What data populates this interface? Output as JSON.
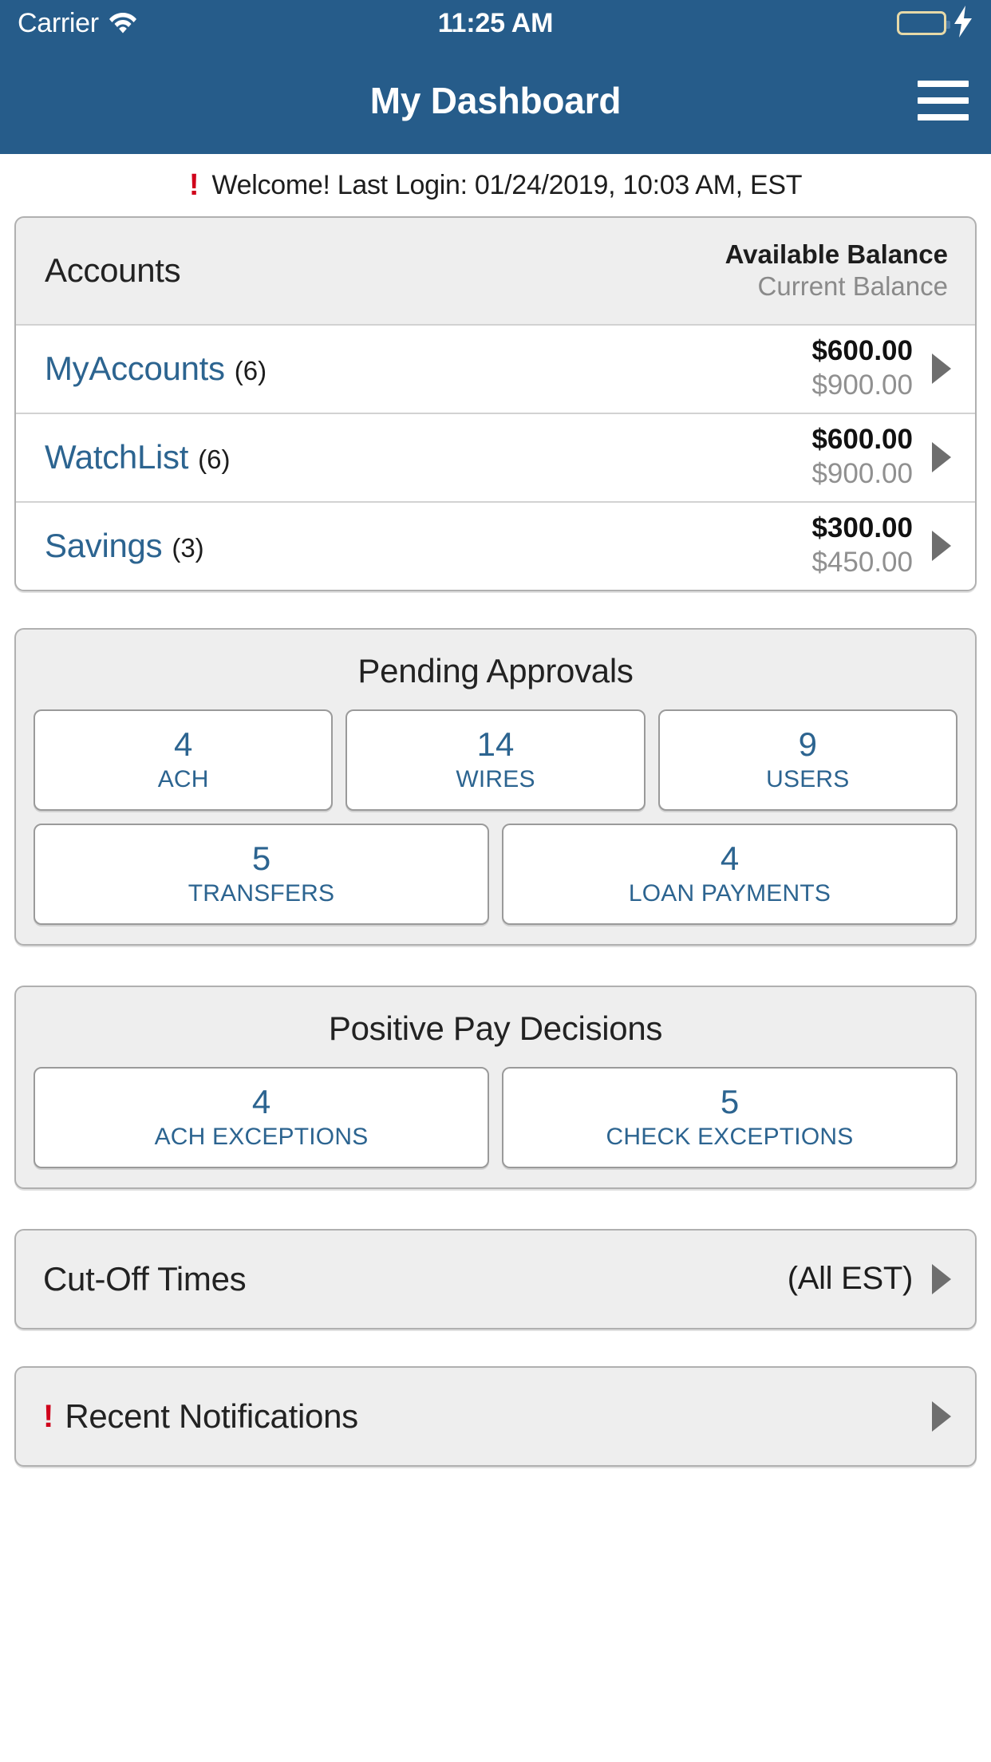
{
  "status_bar": {
    "carrier": "Carrier",
    "time": "11:25 AM",
    "wifi_icon": "wifi-icon",
    "battery_icon": "battery-icon",
    "charging_icon": "lightning-bolt-icon"
  },
  "nav": {
    "title": "My Dashboard",
    "menu_icon": "hamburger-menu-icon"
  },
  "welcome": {
    "alert_icon": "exclamation-icon",
    "message": "Welcome! Last Login: 01/24/2019, 10:03 AM, EST"
  },
  "accounts": {
    "title": "Accounts",
    "available_balance_label": "Available Balance",
    "current_balance_label": "Current Balance",
    "rows": [
      {
        "name": "MyAccounts",
        "count": "(6)",
        "available": "$600.00",
        "current": "$900.00"
      },
      {
        "name": "WatchList",
        "count": "(6)",
        "available": "$600.00",
        "current": "$900.00"
      },
      {
        "name": "Savings",
        "count": "(3)",
        "available": "$300.00",
        "current": "$450.00"
      }
    ]
  },
  "pending_approvals": {
    "title": "Pending Approvals",
    "row1": [
      {
        "count": "4",
        "label": "ACH"
      },
      {
        "count": "14",
        "label": "WIRES"
      },
      {
        "count": "9",
        "label": "USERS"
      }
    ],
    "row2": [
      {
        "count": "5",
        "label": "TRANSFERS"
      },
      {
        "count": "4",
        "label": "LOAN PAYMENTS"
      }
    ]
  },
  "positive_pay": {
    "title": "Positive Pay Decisions",
    "tiles": [
      {
        "count": "4",
        "label": "ACH EXCEPTIONS"
      },
      {
        "count": "5",
        "label": "CHECK EXCEPTIONS"
      }
    ]
  },
  "cut_off_times": {
    "title": "Cut-Off Times",
    "meta": "(All EST)"
  },
  "recent_notifications": {
    "alert_icon": "exclamation-icon",
    "title": "Recent Notifications"
  },
  "colors": {
    "brand_blue": "#265c8a",
    "link_blue": "#2c6490",
    "alert_red": "#d0021b",
    "card_bg": "#eeeeee",
    "muted_gray": "#8a8a8a",
    "battery_green": "#53d769"
  }
}
